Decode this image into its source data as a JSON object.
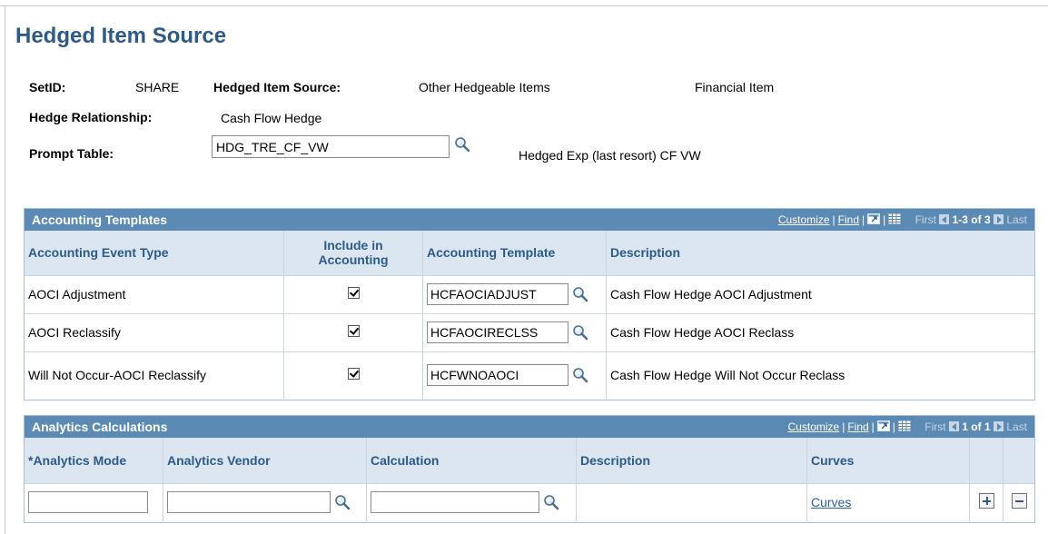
{
  "page": {
    "title": "Hedged Item Source"
  },
  "header": {
    "setid_label": "SetID:",
    "setid_value": "SHARE",
    "hedged_item_source_label": "Hedged Item Source:",
    "hedged_item_source_value": "Other Hedgeable Items",
    "item_type": "Financial Item",
    "hedge_relationship_label": "Hedge Relationship:",
    "hedge_relationship_value": "Cash Flow Hedge",
    "prompt_table_label": "Prompt Table:",
    "prompt_table_value": "HDG_TRE_CF_VW",
    "prompt_table_description": "Hedged Exp (last resort) CF VW"
  },
  "accounting_templates": {
    "title": "Accounting Templates",
    "nav": {
      "customize": "Customize",
      "find": "Find",
      "first": "First",
      "range": "1-3 of 3",
      "last": "Last"
    },
    "columns": [
      "Accounting Event Type",
      "Include in Accounting",
      "Accounting Template",
      "Description"
    ],
    "rows": [
      {
        "event_type": "AOCI Adjustment",
        "included": true,
        "template": "HCFAOCIADJUST",
        "description": "Cash Flow Hedge AOCI Adjustment"
      },
      {
        "event_type": "AOCI Reclassify",
        "included": true,
        "template": "HCFAOCIRECLSS",
        "description": "Cash Flow Hedge AOCI Reclass"
      },
      {
        "event_type": "Will Not Occur-AOCI Reclassify",
        "included": true,
        "template": "HCFWNOAOCI",
        "description": "Cash Flow Hedge Will Not Occur Reclass"
      }
    ]
  },
  "analytics_calculations": {
    "title": "Analytics Calculations",
    "nav": {
      "customize": "Customize",
      "find": "Find",
      "first": "First",
      "range": "1 of 1",
      "last": "Last"
    },
    "columns": [
      "*Analytics Mode",
      "Analytics Vendor",
      "Calculation",
      "Description",
      "Curves"
    ],
    "rows": [
      {
        "analytics_mode": "",
        "analytics_vendor": "",
        "calculation": "",
        "description": "",
        "curves_link": "Curves"
      }
    ]
  },
  "icons": {
    "lookup": "magnifier-icon",
    "zoom": "view-all-icon",
    "download": "grid-download-icon",
    "add_row": "plus-icon",
    "delete_row": "minus-icon"
  },
  "colors": {
    "title": "#2d5a8a",
    "grid_header": "#5b8ab4",
    "column_header_bg": "#dbe6f0",
    "link": "#2a5db0"
  }
}
